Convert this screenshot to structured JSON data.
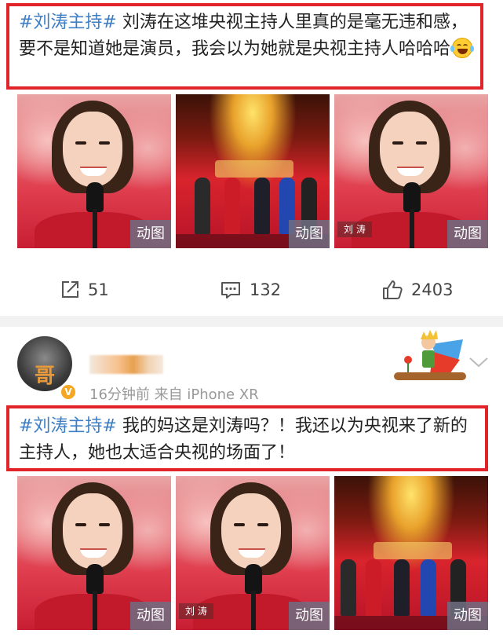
{
  "post1": {
    "hashtag": "#刘涛主持#",
    "text": " 刘涛在这堆央视主持人里真的是毫无违和感，要不是知道她是演员，我会以为她就是央视主持人哈哈哈",
    "emoji": "laughing-tears-emoji",
    "thumbnails": [
      {
        "type": "portrait",
        "badge": "动图",
        "caption": ""
      },
      {
        "type": "stage",
        "badge": "动图",
        "caption": ""
      },
      {
        "type": "portrait",
        "badge": "动图",
        "caption": "刘 涛"
      }
    ],
    "actions": {
      "repost": {
        "icon": "share-icon",
        "count": "51"
      },
      "comment": {
        "icon": "comment-icon",
        "count": "132"
      },
      "like": {
        "icon": "thumbs-up-icon",
        "count": "2403"
      }
    }
  },
  "post2": {
    "avatar_char": "哥",
    "verified_badge": "V",
    "meta": "16分钟前  来自 iPhone XR",
    "hashtag": "#刘涛主持#",
    "text": " 我的妈这是刘涛吗？！我还以为央视来了新的主持人，她也太适合央视的场面了！",
    "thumbnails": [
      {
        "type": "portrait",
        "badge": "动图",
        "caption": ""
      },
      {
        "type": "portrait",
        "badge": "动图",
        "caption": "刘 涛"
      },
      {
        "type": "stage",
        "badge": "动图",
        "caption": ""
      }
    ]
  },
  "colors": {
    "highlight_border": "#e0242a",
    "hashtag": "#3d7ec4",
    "meta": "#999999"
  }
}
